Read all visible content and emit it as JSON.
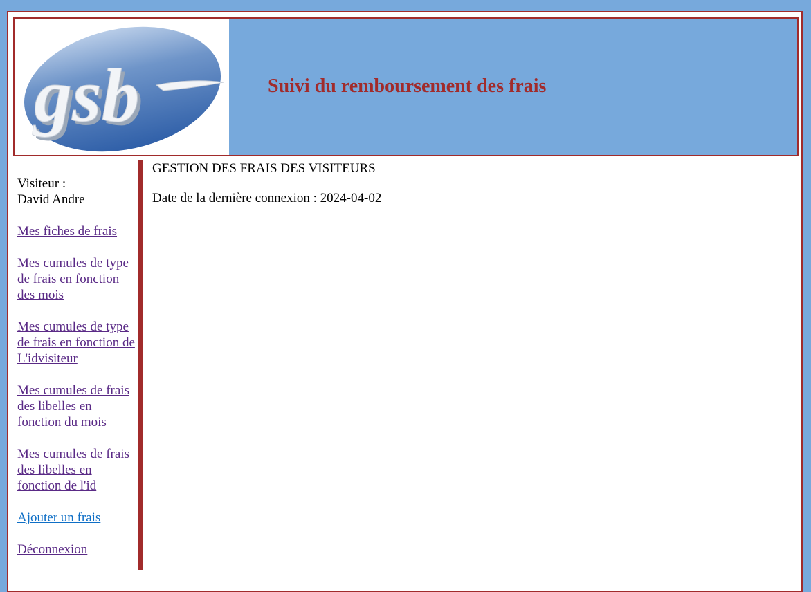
{
  "header": {
    "logo_text": "gsb",
    "title": "Suivi du remboursement des frais"
  },
  "sidebar": {
    "visitor_label": "Visiteur :",
    "visitor_name": "David Andre",
    "items": [
      {
        "label": "Mes fiches de frais"
      },
      {
        "label": "Mes cumules de type de frais en fonction des mois"
      },
      {
        "label": "Mes cumules de type de frais en fonction de L'idvisiteur"
      },
      {
        "label": "Mes cumules de frais des libelles en fonction du mois"
      },
      {
        "label": "Mes cumules de frais des libelles en fonction de l'id"
      },
      {
        "label": "Ajouter un frais"
      },
      {
        "label": "Déconnexion"
      }
    ]
  },
  "main": {
    "heading": "GESTION DES FRAIS DES VISITEURS",
    "last_login_label": "Date de la dernière connexion :",
    "last_login_value": "2024-04-02"
  },
  "colors": {
    "background": "#77a9dc",
    "accent": "#a12b2b",
    "link_visited": "#5a2a86",
    "link_active": "#0f6fc6"
  }
}
